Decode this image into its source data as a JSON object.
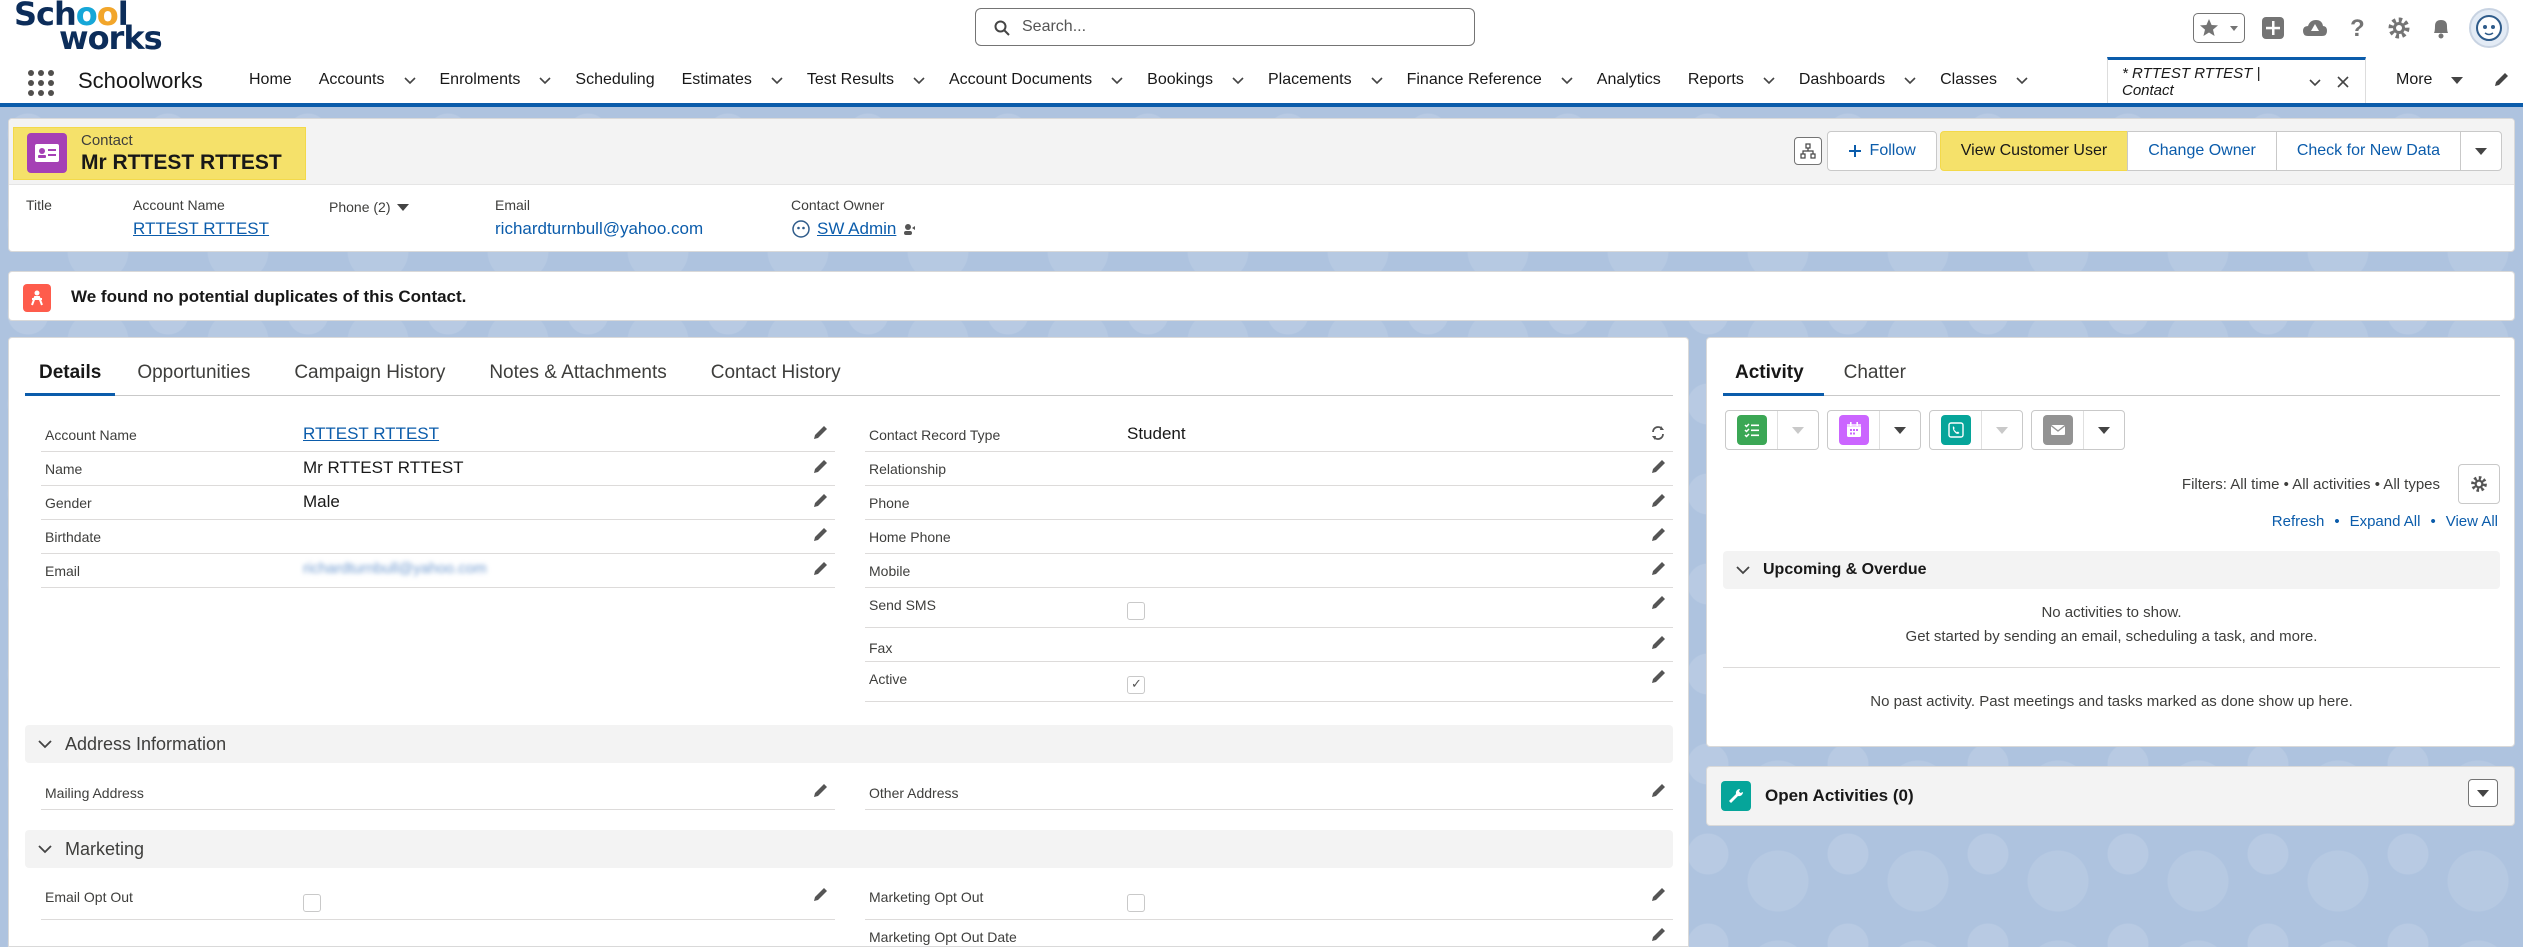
{
  "header": {
    "logo": {
      "line1": "Schooworks",
      "line1_prefix": "Sch",
      "line1_o1": "o",
      "line1_o2": "o",
      "line1_suffix": "l",
      "line2": "works"
    },
    "search_placeholder": "Search..."
  },
  "nav": {
    "app_name": "Schoolworks",
    "items": [
      {
        "label": "Home",
        "has_menu": false
      },
      {
        "label": "Accounts",
        "has_menu": true
      },
      {
        "label": "Enrolments",
        "has_menu": true
      },
      {
        "label": "Scheduling",
        "has_menu": false
      },
      {
        "label": "Estimates",
        "has_menu": true
      },
      {
        "label": "Test Results",
        "has_menu": true
      },
      {
        "label": "Account Documents",
        "has_menu": true
      },
      {
        "label": "Bookings",
        "has_menu": true
      },
      {
        "label": "Placements",
        "has_menu": true
      },
      {
        "label": "Finance Reference",
        "has_menu": true
      },
      {
        "label": "Analytics",
        "has_menu": false
      },
      {
        "label": "Reports",
        "has_menu": true
      },
      {
        "label": "Dashboards",
        "has_menu": true
      },
      {
        "label": "Classes",
        "has_menu": true
      }
    ],
    "active_tab": "* RTTEST RTTEST | Contact",
    "more": "More"
  },
  "record": {
    "object_type": "Contact",
    "name": "Mr RTTEST RTTEST",
    "buttons": {
      "follow": "Follow",
      "view_customer_user": "View Customer User",
      "change_owner": "Change Owner",
      "check_new_data": "Check for New Data"
    },
    "highlights": {
      "title_label": "Title",
      "account_name_label": "Account Name",
      "account_name_value": "RTTEST RTTEST",
      "phone_label": "Phone (2)",
      "email_label": "Email",
      "email_value": "richardturnbull@yahoo.com",
      "owner_label": "Contact Owner",
      "owner_value": "SW Admin"
    }
  },
  "duplicates_banner": "We found no potential duplicates of this Contact.",
  "details": {
    "tabs": [
      "Details",
      "Opportunities",
      "Campaign History",
      "Notes & Attachments",
      "Contact History"
    ],
    "left_fields": [
      {
        "label": "Account Name",
        "value": "RTTEST RTTEST"
      },
      {
        "label": "Name",
        "value": "Mr RTTEST RTTEST"
      },
      {
        "label": "Gender",
        "value": "Male"
      },
      {
        "label": "Birthdate",
        "value": ""
      },
      {
        "label": "Email",
        "value": "richardturnbull@yahoo.com"
      }
    ],
    "right_fields": [
      {
        "label": "Contact Record Type",
        "value": "Student"
      },
      {
        "label": "Relationship",
        "value": ""
      },
      {
        "label": "Phone",
        "value": ""
      },
      {
        "label": "Home Phone",
        "value": ""
      },
      {
        "label": "Mobile",
        "value": ""
      },
      {
        "label": "Send SMS",
        "checked": false
      },
      {
        "label": "Fax",
        "value": ""
      },
      {
        "label": "Active",
        "checked": true
      }
    ],
    "address_section": {
      "title": "Address Information",
      "mailing": "Mailing Address",
      "other": "Other Address"
    },
    "marketing_section": {
      "title": "Marketing",
      "email_opt_out": "Email Opt Out",
      "marketing_opt_out": "Marketing Opt Out",
      "marketing_opt_out_date": "Marketing Opt Out Date"
    }
  },
  "activity": {
    "tabs": [
      "Activity",
      "Chatter"
    ],
    "filters": "Filters: All time • All activities • All types",
    "links": {
      "refresh": "Refresh",
      "expand_all": "Expand All",
      "view_all": "View All",
      "separator": "•"
    },
    "upcoming_title": "Upcoming & Overdue",
    "no_activities": "No activities to show.",
    "get_started": "Get started by sending an email, scheduling a task, and more.",
    "no_past": "No past activity. Past meetings and tasks marked as done show up here.",
    "publisher_colors": {
      "task": "#3ba755",
      "event": "#cb65ff",
      "call": "#06a59a",
      "email": "#939393"
    }
  },
  "open_activities": {
    "title": "Open Activities (0)"
  },
  "colors": {
    "brand_blue": "#0b5cab",
    "highlight_yellow": "#f5e16a",
    "contact_purple": "#a540b5",
    "duplicate_orange": "#fe5c4c"
  }
}
